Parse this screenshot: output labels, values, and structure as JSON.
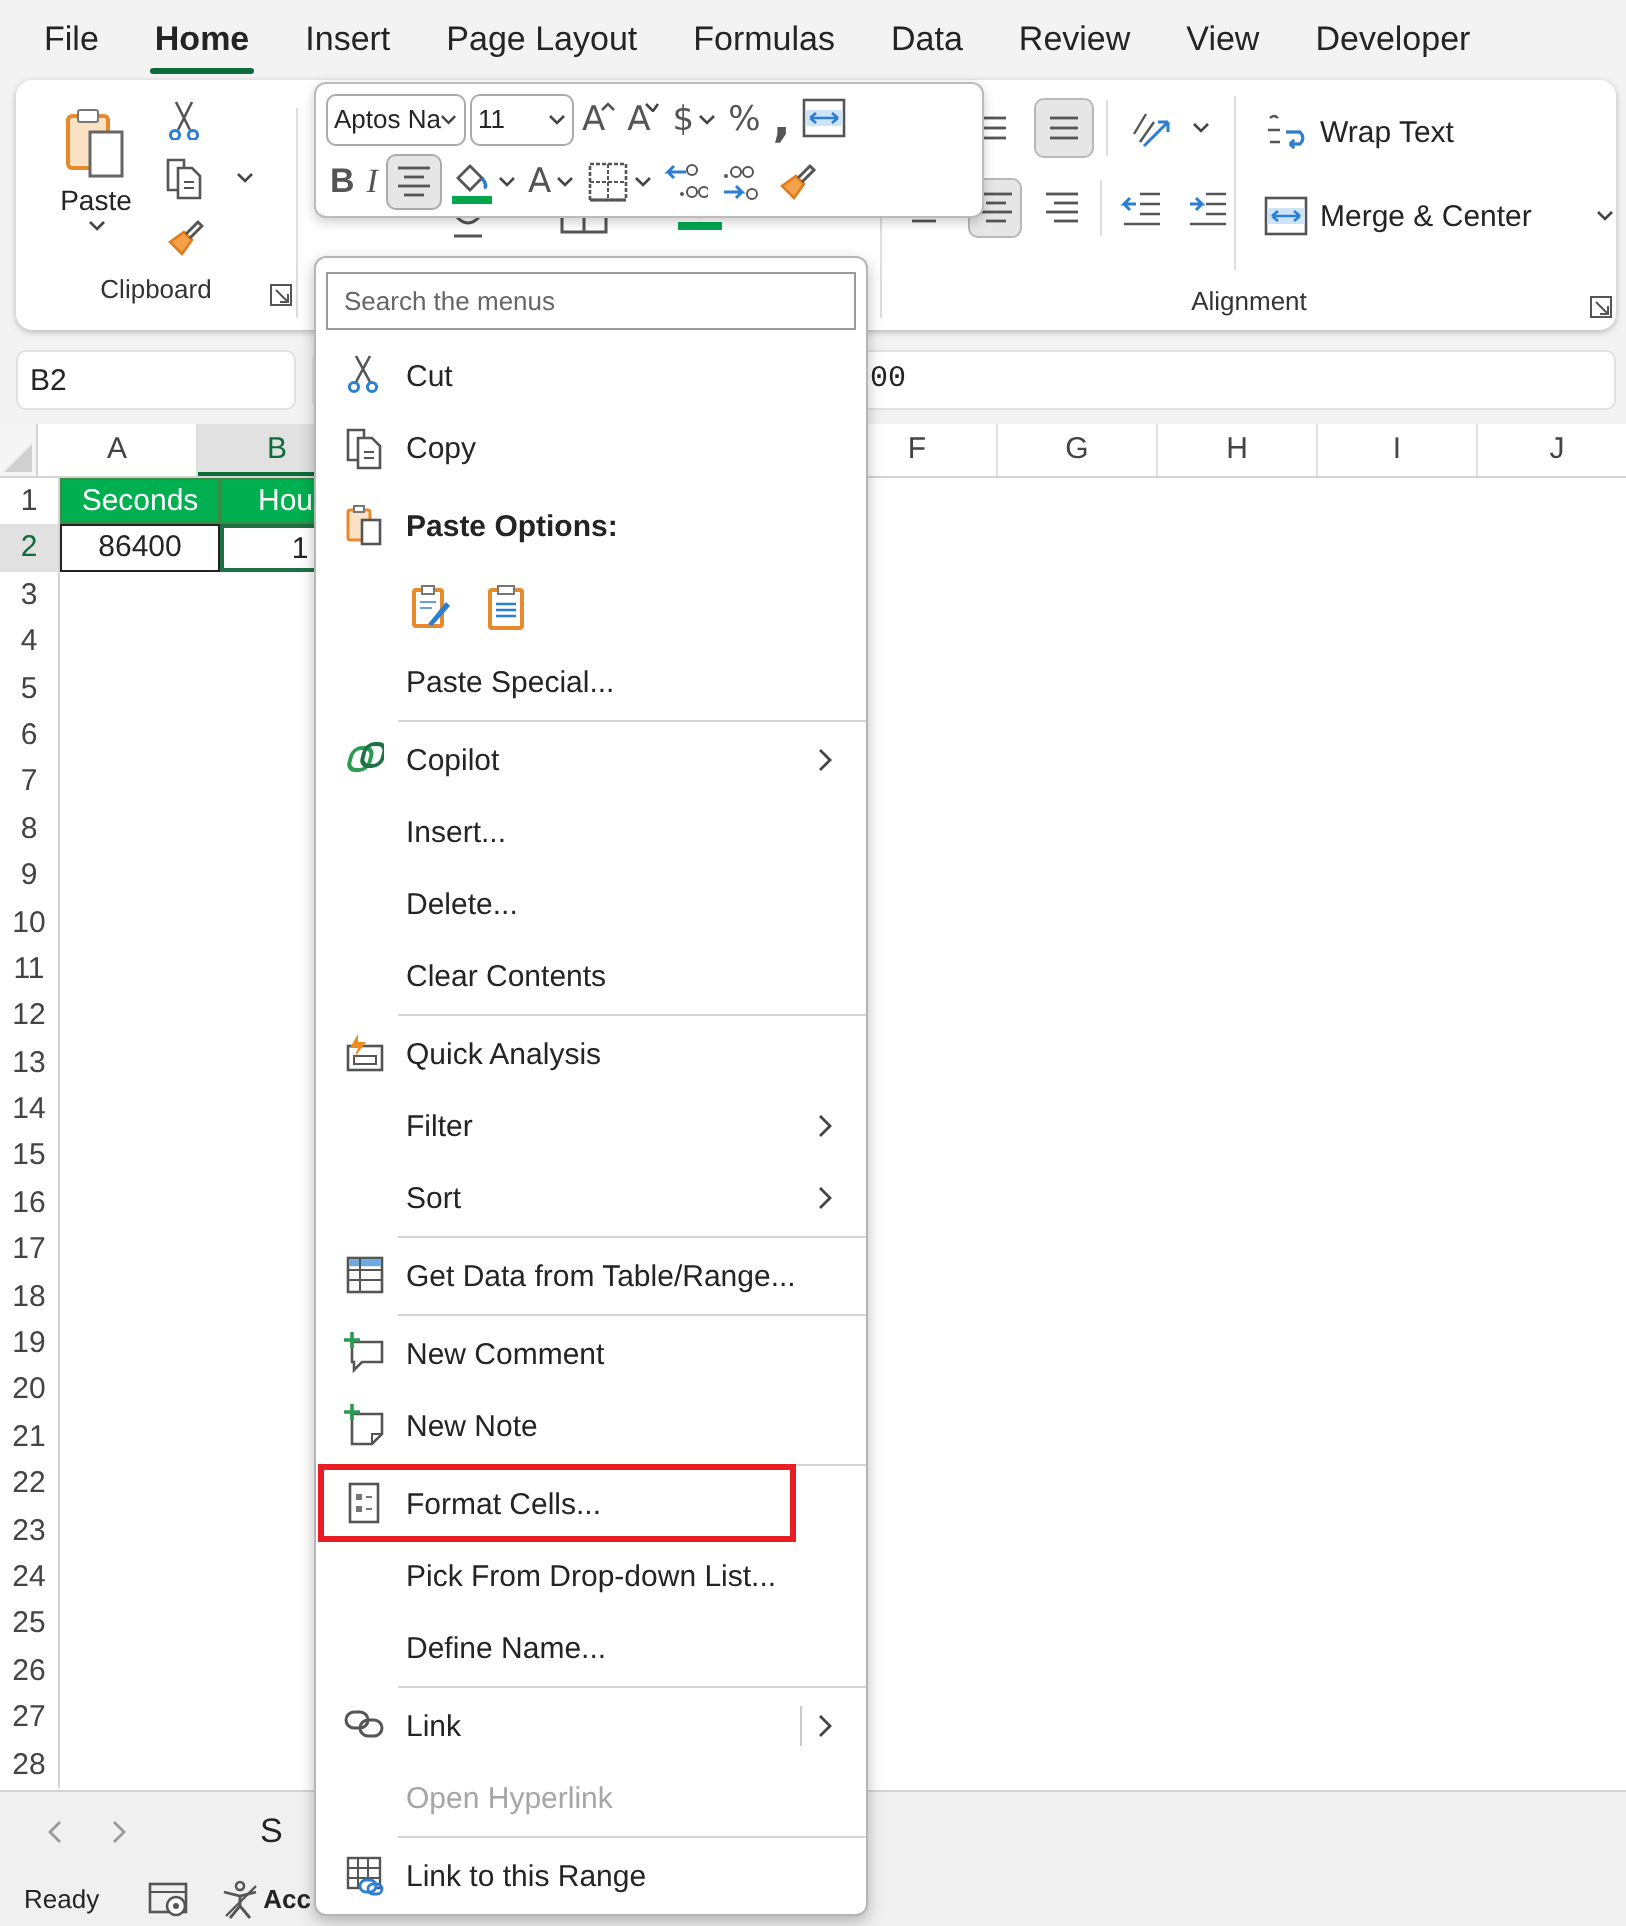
{
  "menu_tabs": [
    {
      "label": "File",
      "selected": false
    },
    {
      "label": "Home",
      "selected": true
    },
    {
      "label": "Insert",
      "selected": false
    },
    {
      "label": "Page Layout",
      "selected": false
    },
    {
      "label": "Formulas",
      "selected": false
    },
    {
      "label": "Data",
      "selected": false
    },
    {
      "label": "Review",
      "selected": false
    },
    {
      "label": "View",
      "selected": false
    },
    {
      "label": "Developer",
      "selected": false
    }
  ],
  "ribbon": {
    "clipboard": {
      "paste": "Paste",
      "group_label": "Clipboard"
    },
    "alignment": {
      "row1": [
        {
          "kind": "top",
          "selected": false
        },
        {
          "kind": "middle",
          "selected": true
        },
        {
          "kind": "orientation",
          "selected": false
        }
      ],
      "row2": [
        {
          "kind": "left",
          "selected": false
        },
        {
          "kind": "center",
          "selected": true
        },
        {
          "kind": "right",
          "selected": false
        },
        {
          "kind": "outdent",
          "selected": false
        },
        {
          "kind": "indent",
          "selected": false
        }
      ],
      "wrap_text": "Wrap Text",
      "merge": "Merge & Center",
      "group_label": "Alignment"
    }
  },
  "mini_toolbar": {
    "font": "Aptos Na",
    "size": "11",
    "row1": [
      {
        "kind": "glyph",
        "label": "A",
        "dropdown": false,
        "selected": false
      },
      {
        "kind": "glyph",
        "label": "A",
        "dropdown": false,
        "selected": false
      },
      {
        "kind": "glyph",
        "label": "$",
        "dropdown": true,
        "selected": false
      },
      {
        "kind": "glyph",
        "label": "%",
        "dropdown": false,
        "selected": false
      },
      {
        "kind": "glyph",
        "label": ",",
        "dropdown": false,
        "selected": false
      },
      {
        "kind": "icon",
        "dropdown": false,
        "selected": false
      }
    ],
    "row2": [
      {
        "kind": "glyph",
        "label": "B",
        "dropdown": false,
        "selected": false
      },
      {
        "kind": "glyph",
        "label": "I",
        "dropdown": false,
        "selected": false
      },
      {
        "kind": "icon",
        "dropdown": false,
        "selected": true
      },
      {
        "kind": "icon",
        "dropdown": true,
        "selected": false
      },
      {
        "kind": "glyph",
        "label": "A",
        "dropdown": true,
        "selected": false
      },
      {
        "kind": "icon",
        "dropdown": true,
        "selected": false
      },
      {
        "kind": "icon",
        "dropdown": false,
        "selected": false
      },
      {
        "kind": "icon",
        "dropdown": false,
        "selected": false
      },
      {
        "kind": "icon",
        "dropdown": false,
        "selected": false
      }
    ]
  },
  "formula_bar": {
    "name_box": "B2",
    "value": "00"
  },
  "sheet": {
    "columns": [
      {
        "label": "A",
        "selected": false
      },
      {
        "label": "B",
        "selected": true
      },
      {
        "label": "F",
        "selected": false
      },
      {
        "label": "G",
        "selected": false
      },
      {
        "label": "H",
        "selected": false
      },
      {
        "label": "I",
        "selected": false
      },
      {
        "label": "J",
        "selected": false
      }
    ],
    "rows": [
      {
        "label": "1",
        "selected": false,
        "cells": [
          {
            "text": "Seconds",
            "kind": "header",
            "selected": false
          },
          {
            "text": "Hou",
            "kind": "header",
            "selected": false
          }
        ]
      },
      {
        "label": "2",
        "selected": true,
        "cells": [
          {
            "text": "86400",
            "kind": "value",
            "selected": false
          },
          {
            "text": "1",
            "kind": "value",
            "selected": true
          }
        ]
      },
      {
        "label": "3",
        "selected": false
      },
      {
        "label": "4",
        "selected": false
      },
      {
        "label": "5",
        "selected": false
      },
      {
        "label": "6",
        "selected": false
      },
      {
        "label": "7",
        "selected": false
      },
      {
        "label": "8",
        "selected": false
      },
      {
        "label": "9",
        "selected": false
      },
      {
        "label": "10",
        "selected": false
      },
      {
        "label": "11",
        "selected": false
      },
      {
        "label": "12",
        "selected": false
      },
      {
        "label": "13",
        "selected": false
      },
      {
        "label": "14",
        "selected": false
      },
      {
        "label": "15",
        "selected": false
      },
      {
        "label": "16",
        "selected": false
      },
      {
        "label": "17",
        "selected": false
      },
      {
        "label": "18",
        "selected": false
      },
      {
        "label": "19",
        "selected": false
      },
      {
        "label": "20",
        "selected": false
      },
      {
        "label": "21",
        "selected": false
      },
      {
        "label": "22",
        "selected": false
      },
      {
        "label": "23",
        "selected": false
      },
      {
        "label": "24",
        "selected": false
      },
      {
        "label": "25",
        "selected": false
      },
      {
        "label": "26",
        "selected": false
      },
      {
        "label": "27",
        "selected": false
      },
      {
        "label": "28",
        "selected": false
      }
    ]
  },
  "sheet_tabs": [
    {
      "label": "S",
      "selected": true
    }
  ],
  "status_bar": {
    "ready": "Ready",
    "accessibility": "Acc"
  },
  "context_menu": {
    "search": {
      "placeholder": "Search the menus"
    },
    "items": [
      {
        "kind": "command",
        "label": "Cut",
        "submenu": false,
        "disabled": false,
        "highlighted": false
      },
      {
        "kind": "command",
        "label": "Copy",
        "submenu": false,
        "disabled": false,
        "highlighted": false
      },
      {
        "kind": "heading",
        "label": "Paste Options:"
      },
      {
        "kind": "paste-buttons"
      },
      {
        "kind": "command",
        "label": "Paste Special...",
        "submenu": false,
        "disabled": false,
        "highlighted": false
      },
      {
        "kind": "separator"
      },
      {
        "kind": "command",
        "label": "Copilot",
        "submenu": true,
        "disabled": false,
        "highlighted": false
      },
      {
        "kind": "command",
        "label": "Insert...",
        "submenu": false,
        "disabled": false,
        "highlighted": false
      },
      {
        "kind": "command",
        "label": "Delete...",
        "submenu": false,
        "disabled": false,
        "highlighted": false
      },
      {
        "kind": "command",
        "label": "Clear Contents",
        "submenu": false,
        "disabled": false,
        "highlighted": false
      },
      {
        "kind": "separator"
      },
      {
        "kind": "command",
        "label": "Quick Analysis",
        "submenu": false,
        "disabled": false,
        "highlighted": false
      },
      {
        "kind": "command",
        "label": "Filter",
        "submenu": true,
        "disabled": false,
        "highlighted": false
      },
      {
        "kind": "command",
        "label": "Sort",
        "submenu": true,
        "disabled": false,
        "highlighted": false
      },
      {
        "kind": "separator"
      },
      {
        "kind": "command",
        "label": "Get Data from Table/Range...",
        "submenu": false,
        "disabled": false,
        "highlighted": false
      },
      {
        "kind": "separator"
      },
      {
        "kind": "command",
        "label": "New Comment",
        "submenu": false,
        "disabled": false,
        "highlighted": false
      },
      {
        "kind": "command",
        "label": "New Note",
        "submenu": false,
        "disabled": false,
        "highlighted": false
      },
      {
        "kind": "separator"
      },
      {
        "kind": "command",
        "label": "Format Cells...",
        "submenu": false,
        "disabled": false,
        "highlighted": true
      },
      {
        "kind": "command",
        "label": "Pick From Drop-down List...",
        "submenu": false,
        "disabled": false,
        "highlighted": false
      },
      {
        "kind": "command",
        "label": "Define Name...",
        "submenu": false,
        "disabled": false,
        "highlighted": false
      },
      {
        "kind": "separator"
      },
      {
        "kind": "command",
        "label": "Link",
        "submenu": true,
        "disabled": false,
        "highlighted": false
      },
      {
        "kind": "command",
        "label": "Open Hyperlink",
        "submenu": false,
        "disabled": true,
        "highlighted": false
      },
      {
        "kind": "separator"
      },
      {
        "kind": "command",
        "label": "Link to this Range",
        "submenu": false,
        "disabled": false,
        "highlighted": false
      }
    ]
  }
}
